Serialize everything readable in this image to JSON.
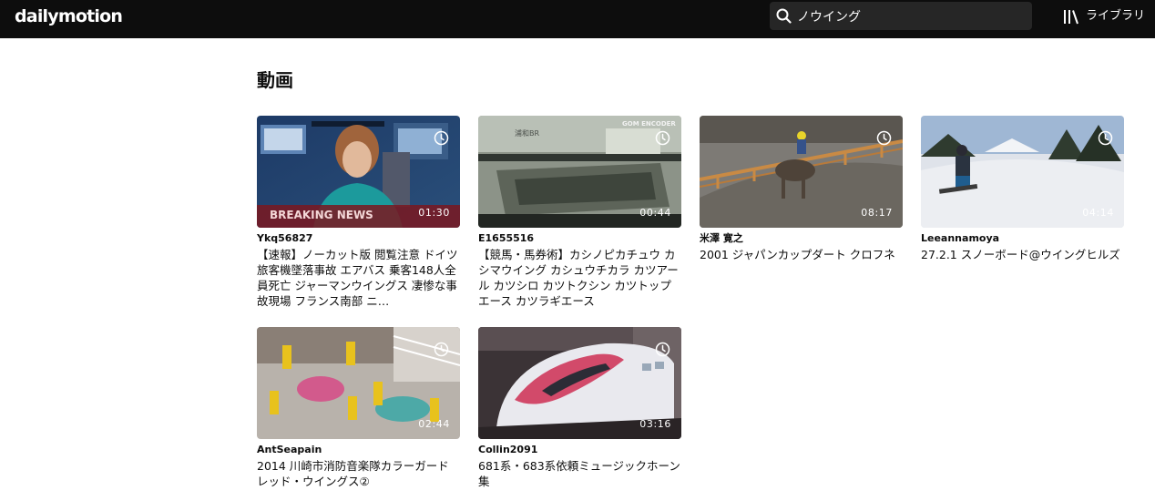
{
  "header": {
    "logo": "dailymotion",
    "search_value": "ノウイング",
    "library_label": "ライブラリ"
  },
  "section_title": "動画",
  "videos": [
    {
      "channel": "Ykq56827",
      "duration": "01:30",
      "title": "【速報】ノーカット版 閲覧注意 ドイツ旅客機墜落事故 エアバス 乗客148人全員死亡 ジャーマンウイングス 凄惨な事故現場 フランス南部 ニ…"
    },
    {
      "channel": "E1655516",
      "duration": "00:44",
      "title": "【競馬・馬券術】カシノピカチュウ カシマウイング カシュウチカラ カツアール カツシロ カツトクシン カツトップエース カツラギエース"
    },
    {
      "channel": "米澤 寛之",
      "duration": "08:17",
      "title": "2001 ジャパンカップダート クロフネ"
    },
    {
      "channel": "Leeannamoya",
      "duration": "04:14",
      "title": "27.2.1 スノーボード@ウイングヒルズ"
    },
    {
      "channel": "AntSeapain",
      "duration": "02:44",
      "title": "2014 川崎市消防音楽隊カラーガード レッド・ウイングス②"
    },
    {
      "channel": "Collin2091",
      "duration": "03:16",
      "title": "681系・683系依頼ミュージックホーン集"
    }
  ],
  "thumbnail_overlays": {
    "breaking_news": "BREAKING NEWS",
    "encoder_logo": "GOM ENCODER",
    "station_text": "浦和BR"
  },
  "icons": [
    "search-icon",
    "library-icon",
    "watch-later-icon"
  ],
  "colors": {
    "header_bg": "#0d0d0d",
    "search_bg": "#262626",
    "text": "#0d0d0d"
  }
}
